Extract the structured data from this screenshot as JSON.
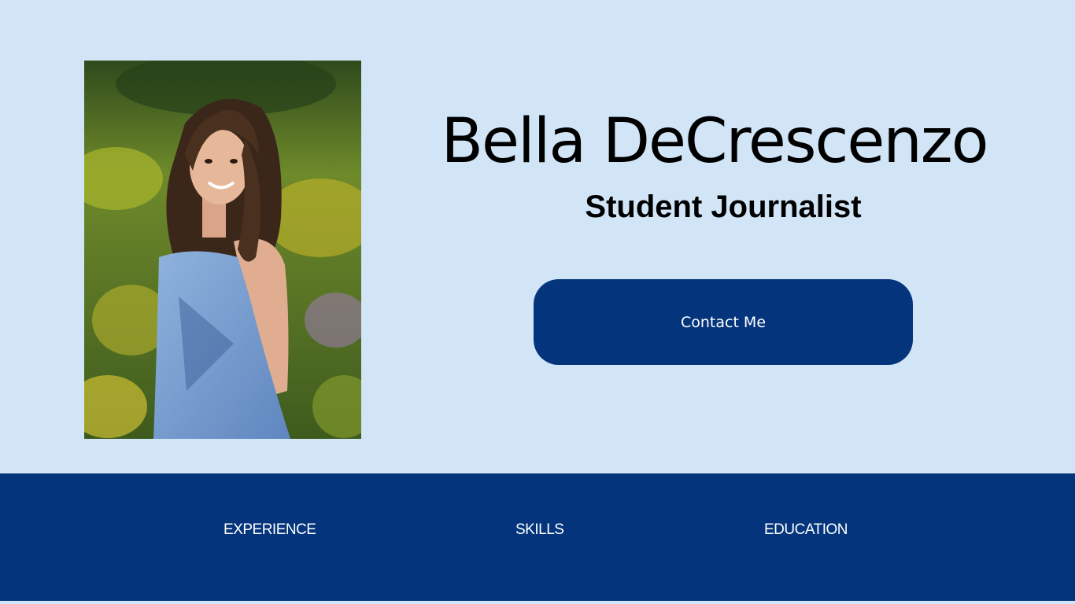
{
  "hero": {
    "name": "Bella DeCrescenzo",
    "role": "Student Journalist",
    "contact_label": "Contact Me"
  },
  "nav": {
    "items": [
      {
        "label": "EXPERIENCE"
      },
      {
        "label": "SKILLS"
      },
      {
        "label": "EDUCATION"
      }
    ]
  },
  "colors": {
    "background": "#d1e5f7",
    "brand_navy": "#04357c",
    "text_dark": "#000000",
    "text_light": "#ffffff"
  }
}
